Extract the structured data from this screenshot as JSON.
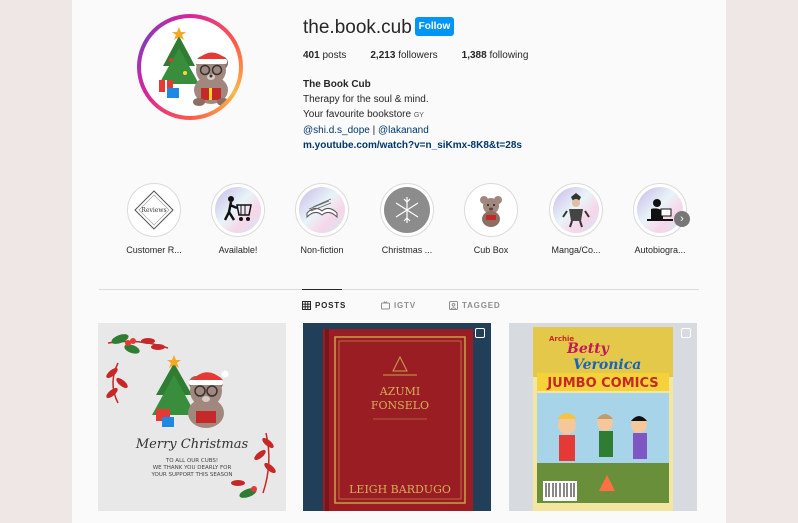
{
  "profile": {
    "username": "the.book.cub",
    "follow_label": "Follow",
    "posts_count": "401",
    "posts_label": "posts",
    "followers_count": "2,213",
    "followers_label": "followers",
    "following_count": "1,388",
    "following_label": "following",
    "display_name": "The Book Cub",
    "bio_line1": "Therapy for the soul & mind.",
    "bio_line2": "Your favourite bookstore",
    "bio_gy": "GY",
    "mention1": "@shi.d.s_dope",
    "separator": " | ",
    "mention2": "@lakanand",
    "url": "m.youtube.com/watch?v=n_siKmx-8K8&t=28s"
  },
  "highlights": [
    {
      "label": "Customer R...",
      "icon": "reviews-badge-icon",
      "inner_text": "Reviews"
    },
    {
      "label": "Available!",
      "icon": "shopping-cart-icon"
    },
    {
      "label": "Non-fiction",
      "icon": "open-book-icon"
    },
    {
      "label": "Christmas ...",
      "icon": "snowflake-icon"
    },
    {
      "label": "Cub Box",
      "icon": "teddy-bear-icon"
    },
    {
      "label": "Manga/Co...",
      "icon": "manga-character-icon"
    },
    {
      "label": "Autobiogra...",
      "icon": "reading-person-icon"
    }
  ],
  "highlights_next": "›",
  "tabs": [
    {
      "label": "POSTS",
      "icon": "grid-icon",
      "active": true
    },
    {
      "label": "IGTV",
      "icon": "tv-icon",
      "active": false
    },
    {
      "label": "TAGGED",
      "icon": "tag-icon",
      "active": false
    }
  ],
  "posts": [
    {
      "title": "Merry Christmas",
      "line1": "TO ALL OUR CUBS!",
      "line2": "WE THANK YOU DEARLY FOR",
      "line3": "YOUR SUPPORT THIS SEASON"
    },
    {
      "book_title_line1": "AZUMI",
      "book_title_line2": "FONSELO",
      "author": "LEIGH BARDUGO",
      "multi": true
    },
    {
      "brand": "Archie",
      "title1": "Betty",
      "title2": "Veronica",
      "title3": "JUMBO COMICS",
      "multi": true
    }
  ],
  "colors": {
    "follow": "#0095f6",
    "link": "#00376b",
    "background": "#efe6e6"
  }
}
